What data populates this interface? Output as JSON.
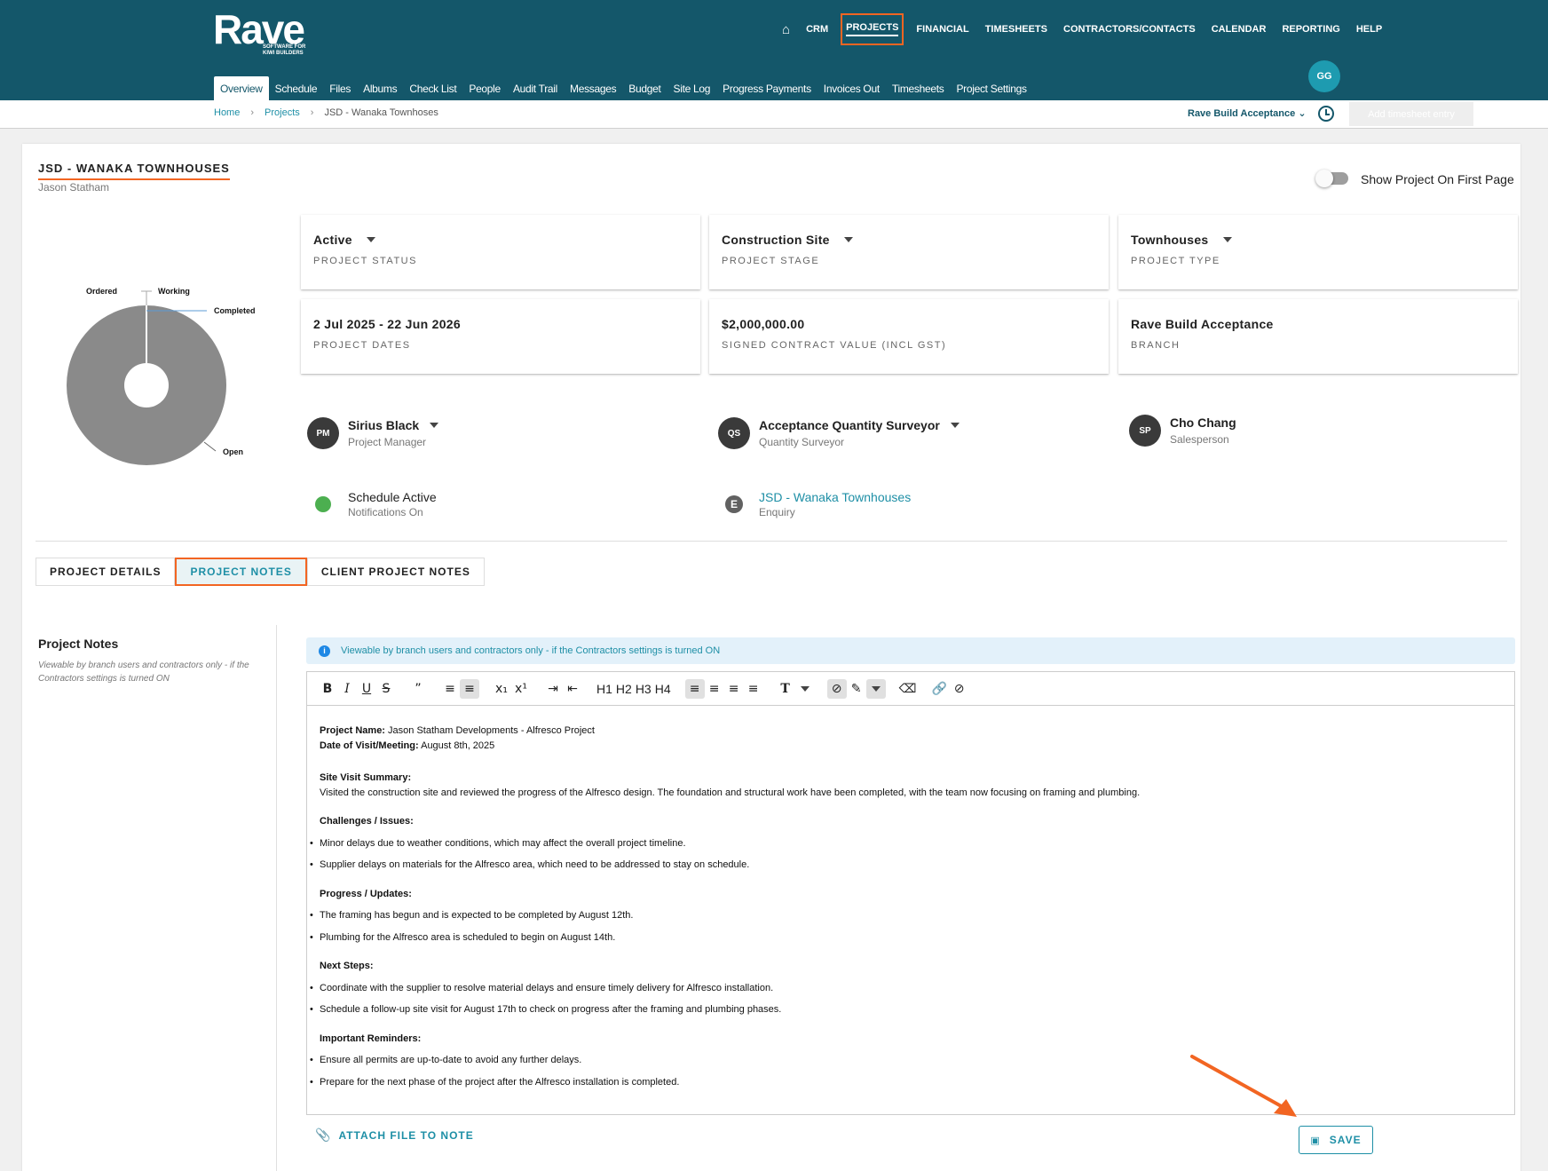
{
  "logo": {
    "name": "Rave",
    "tagline": "SOFTWARE FOR KIWI BUILDERS"
  },
  "main_nav": {
    "home_icon": "home-icon",
    "items": [
      "CRM",
      "PROJECTS",
      "FINANCIAL",
      "TIMESHEETS",
      "CONTRACTORS/CONTACTS",
      "CALENDAR",
      "REPORTING",
      "HELP"
    ],
    "active": "PROJECTS"
  },
  "sub_nav": {
    "items": [
      "Overview",
      "Schedule",
      "Files",
      "Albums",
      "Check List",
      "People",
      "Audit Trail",
      "Messages",
      "Budget",
      "Site Log",
      "Progress Payments",
      "Invoices Out",
      "Timesheets",
      "Project Settings"
    ],
    "active": "Overview"
  },
  "user": {
    "initials": "GG"
  },
  "breadcrumb": {
    "home": "Home",
    "projects": "Projects",
    "current": "JSD - Wanaka Townhoses"
  },
  "branch_selector": {
    "value": "Rave Build Acceptance"
  },
  "timesheet_button": {
    "label": "Add timesheet entry"
  },
  "project": {
    "title": "JSD - WANAKA TOWNHOUSES",
    "owner": "Jason Statham",
    "show_on_first_page_label": "Show Project On First Page"
  },
  "chart_data": {
    "type": "pie",
    "labels": [
      "Ordered",
      "Working",
      "Completed",
      "Open"
    ],
    "values": [
      0,
      0,
      0,
      100
    ],
    "colors": {
      "Open": "#8a8a8a"
    }
  },
  "info_cards": [
    {
      "value": "Active",
      "label": "PROJECT STATUS",
      "dropdown": true
    },
    {
      "value": "Construction Site",
      "label": "PROJECT STAGE",
      "dropdown": true
    },
    {
      "value": "Townhouses",
      "label": "PROJECT TYPE",
      "dropdown": true
    },
    {
      "value": "2 Jul 2025  - 22 Jun 2026",
      "label": "PROJECT DATES",
      "dropdown": false
    },
    {
      "value": "$2,000,000.00",
      "label": "SIGNED CONTRACT VALUE (INCL GST)",
      "dropdown": false
    },
    {
      "value": "Rave Build Acceptance",
      "label": "BRANCH",
      "dropdown": false
    }
  ],
  "people": [
    {
      "initials": "PM",
      "name": "Sirius Black",
      "role": "Project Manager"
    },
    {
      "initials": "QS",
      "name": "Acceptance Quantity Surveyor",
      "role": "Quantity Surveyor"
    },
    {
      "initials": "SP",
      "name": "Cho Chang",
      "role": "Salesperson"
    }
  ],
  "schedule": {
    "title": "Schedule Active",
    "subtitle": "Notifications On",
    "status_color": "#4caf50"
  },
  "enquiry": {
    "badge": "E",
    "link": "JSD - Wanaka Townhouses",
    "subtitle": "Enquiry"
  },
  "tabs": {
    "items": [
      "PROJECT DETAILS",
      "PROJECT NOTES",
      "CLIENT PROJECT NOTES"
    ],
    "active": "PROJECT NOTES"
  },
  "notes_panel": {
    "heading": "Project Notes",
    "description": "Viewable by branch users and contractors only - if the Contractors settings is turned ON",
    "alert": "Viewable by branch users and contractors only - if the Contractors settings is turned ON"
  },
  "editor": {
    "toolbar": {
      "bold": "B",
      "italic": "I",
      "underline": "U",
      "strike": "S",
      "h1": "H1",
      "h2": "H2",
      "h3": "H3",
      "h4": "H4",
      "text_style": "T"
    },
    "project_name_label": "Project Name:",
    "project_name": " Jason Statham Developments - Alfresco Project",
    "date_label": "Date of Visit/Meeting:",
    "date": " August 8th, 2025",
    "summary_heading": "Site Visit Summary:",
    "summary_text": "Visited the construction site and reviewed the progress of the Alfresco design. The foundation and structural work have been completed, with the team now focusing on framing and plumbing.",
    "challenges_heading": "Challenges / Issues:",
    "challenges": [
      "Minor delays due to weather conditions, which may affect the overall project timeline.",
      "Supplier delays on materials for the Alfresco area, which need to be addressed to stay on schedule."
    ],
    "progress_heading": "Progress / Updates:",
    "progress": [
      "The framing has begun and is expected to be completed by August 12th.",
      "Plumbing for the Alfresco area is scheduled to begin on August 14th."
    ],
    "next_heading": "Next Steps:",
    "next_steps": [
      "Coordinate with the supplier to resolve material delays and ensure timely delivery for Alfresco installation.",
      "Schedule a follow-up site visit for August 17th to check on progress after the framing and plumbing phases."
    ],
    "reminders_heading": "Important Reminders:",
    "reminders": [
      "Ensure all permits are up-to-date to avoid any further delays.",
      "Prepare for the next phase of the project after the Alfresco installation is completed."
    ]
  },
  "attach_button": {
    "label": "ATTACH FILE TO NOTE"
  },
  "save_button": {
    "label": "SAVE"
  },
  "accent_colors": {
    "brand": "#14576a",
    "link": "#1e8fa6",
    "highlight": "#f26522"
  }
}
